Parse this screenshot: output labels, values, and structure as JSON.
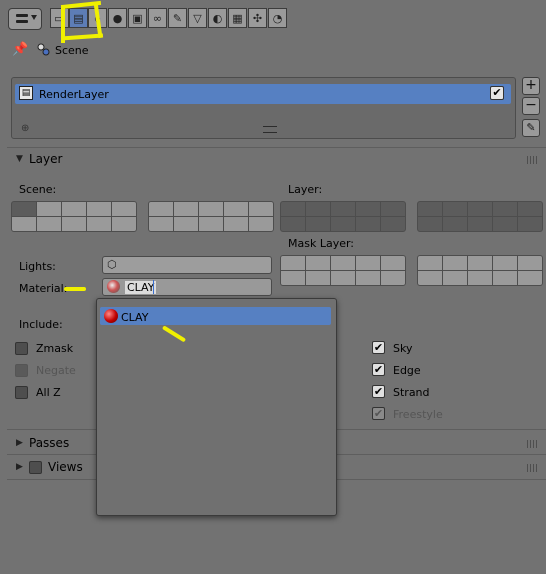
{
  "header": {
    "editor_type": "properties-editor",
    "context_icons": [
      "render-icon",
      "render-layers-icon",
      "scene-icon",
      "world-icon",
      "object-icon",
      "constraints-icon",
      "modifiers-icon",
      "data-icon",
      "material-icon",
      "texture-icon",
      "particles-icon",
      "physics-icon"
    ]
  },
  "breadcrumb": {
    "scene_label": "Scene"
  },
  "render_layers": {
    "items": [
      {
        "label": "RenderLayer",
        "enabled": true
      }
    ]
  },
  "layer_panel": {
    "title": "Layer",
    "scene_label": "Scene:",
    "layer_label": "Layer:",
    "mask_layer_label": "Mask Layer:",
    "lights_label": "Lights:",
    "material_label": "Material:",
    "material_value": "CLAY",
    "include_label": "Include:",
    "left_options": [
      {
        "label": "Zmask",
        "checked": false,
        "disabled": false
      },
      {
        "label": "Negate",
        "checked": false,
        "disabled": true
      },
      {
        "label": "All Z",
        "checked": false,
        "disabled": false
      }
    ],
    "right_options": [
      {
        "label": "Sky",
        "checked": true,
        "disabled": false
      },
      {
        "label": "Edge",
        "checked": true,
        "disabled": false
      },
      {
        "label": "Strand",
        "checked": true,
        "disabled": false
      },
      {
        "label": "Freestyle",
        "checked": true,
        "disabled": true
      }
    ]
  },
  "passes_panel": {
    "title": "Passes"
  },
  "views_panel": {
    "title": "Views"
  },
  "material_dropdown": {
    "items": [
      {
        "label": "CLAY"
      }
    ]
  },
  "colors": {
    "selection": "#5680c2",
    "annotation": "#f0f000",
    "background": "#727272"
  }
}
